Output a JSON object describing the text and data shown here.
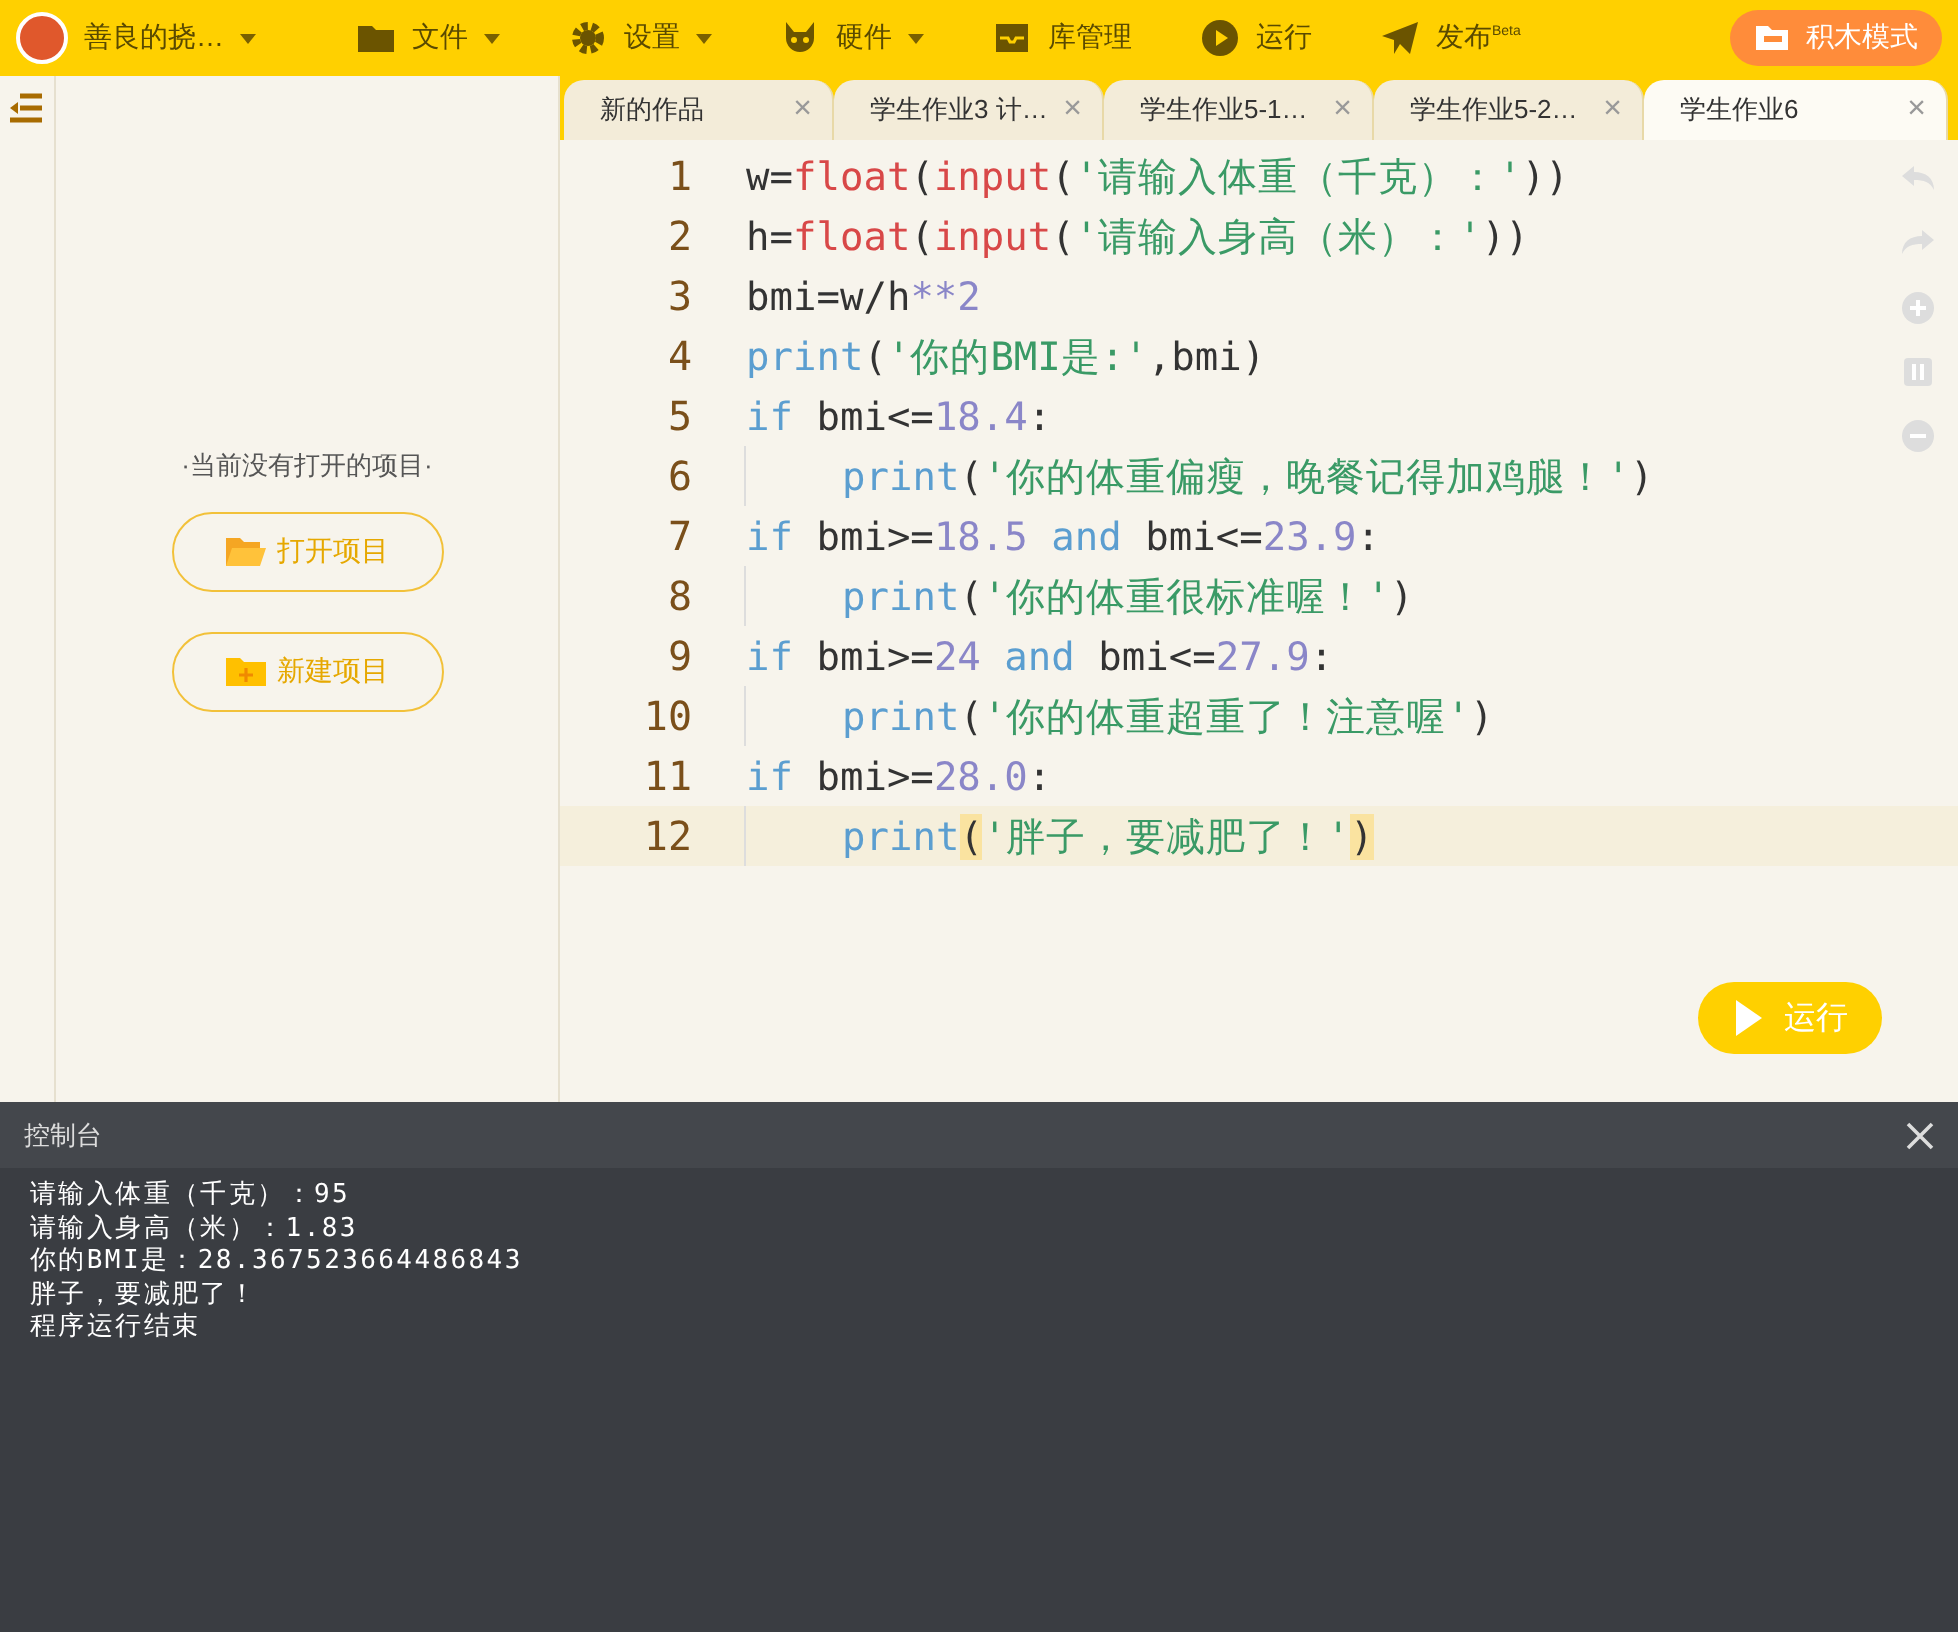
{
  "toolbar": {
    "user": {
      "label": "善良的挠…",
      "dropdown": true
    },
    "menus": [
      {
        "kind": "folder",
        "label": "文件",
        "dropdown": true
      },
      {
        "kind": "gear",
        "label": "设置",
        "dropdown": true
      },
      {
        "kind": "hardware",
        "label": "硬件",
        "dropdown": true
      },
      {
        "kind": "library",
        "label": "库管理",
        "dropdown": false
      },
      {
        "kind": "run",
        "label": "运行",
        "dropdown": false
      },
      {
        "kind": "send",
        "label": "发布$^{Beta}$",
        "dropdown": false
      }
    ],
    "mode_button": "积木模式"
  },
  "sidebar": {
    "message": "·当前没有打开的项目·",
    "buttons": [
      {
        "kind": "open",
        "label": "打开项目"
      },
      {
        "kind": "new",
        "label": "新建项目"
      }
    ]
  },
  "tabs": [
    {
      "label": "新的作品",
      "close": "×",
      "selected": false
    },
    {
      "label": "学生作业3 计…",
      "close": "×",
      "selected": false
    },
    {
      "label": "学生作业5-1…",
      "close": "×",
      "selected": false
    },
    {
      "label": "学生作业5-2…",
      "close": "×",
      "selected": false
    },
    {
      "label": "学生作业6",
      "close": "×",
      "selected": true
    }
  ],
  "editor": {
    "lines": [
      {
        "number": "1",
        "indented": false,
        "current": false,
        "tokens": [
          {
            "kind": "plain",
            "text": "w="
          },
          {
            "kind": "builtin",
            "text": "float"
          },
          {
            "kind": "plain",
            "text": "("
          },
          {
            "kind": "builtin",
            "text": "input"
          },
          {
            "kind": "plain",
            "text": "("
          },
          {
            "kind": "string",
            "text": "'请输入体重（千克）：'"
          },
          {
            "kind": "plain",
            "text": "))"
          }
        ]
      },
      {
        "number": "2",
        "indented": false,
        "current": false,
        "tokens": [
          {
            "kind": "plain",
            "text": "h="
          },
          {
            "kind": "builtin",
            "text": "float"
          },
          {
            "kind": "plain",
            "text": "("
          },
          {
            "kind": "builtin",
            "text": "input"
          },
          {
            "kind": "plain",
            "text": "("
          },
          {
            "kind": "string",
            "text": "'请输入身高（米）：'"
          },
          {
            "kind": "plain",
            "text": "))"
          }
        ]
      },
      {
        "number": "3",
        "indented": false,
        "current": false,
        "tokens": [
          {
            "kind": "plain",
            "text": "bmi=w/h"
          },
          {
            "kind": "operator",
            "text": "**"
          },
          {
            "kind": "number",
            "text": "2"
          }
        ]
      },
      {
        "number": "4",
        "indented": false,
        "current": false,
        "tokens": [
          {
            "kind": "keyword",
            "text": "print"
          },
          {
            "kind": "plain",
            "text": "("
          },
          {
            "kind": "string",
            "text": "'你的BMI是:'"
          },
          {
            "kind": "plain",
            "text": ",bmi)"
          }
        ]
      },
      {
        "number": "5",
        "indented": false,
        "current": false,
        "tokens": [
          {
            "kind": "keyword",
            "text": "if"
          },
          {
            "kind": "plain",
            "text": " bmi<="
          },
          {
            "kind": "number",
            "text": "18.4"
          },
          {
            "kind": "plain",
            "text": ":"
          }
        ]
      },
      {
        "number": "6",
        "indented": true,
        "current": false,
        "tokens": [
          {
            "kind": "keyword",
            "text": "print"
          },
          {
            "kind": "plain",
            "text": "("
          },
          {
            "kind": "string",
            "text": "'你的体重偏瘦，晚餐记得加鸡腿！'"
          },
          {
            "kind": "plain",
            "text": ")"
          }
        ]
      },
      {
        "number": "7",
        "indented": false,
        "current": false,
        "tokens": [
          {
            "kind": "keyword",
            "text": "if"
          },
          {
            "kind": "plain",
            "text": " bmi>="
          },
          {
            "kind": "number",
            "text": "18.5"
          },
          {
            "kind": "keyword",
            "text": " and"
          },
          {
            "kind": "plain",
            "text": " bmi<="
          },
          {
            "kind": "number",
            "text": "23.9"
          },
          {
            "kind": "plain",
            "text": ":"
          }
        ]
      },
      {
        "number": "8",
        "indented": true,
        "current": false,
        "tokens": [
          {
            "kind": "keyword",
            "text": "print"
          },
          {
            "kind": "plain",
            "text": "("
          },
          {
            "kind": "string",
            "text": "'你的体重很标准喔！'"
          },
          {
            "kind": "plain",
            "text": ")"
          }
        ]
      },
      {
        "number": "9",
        "indented": false,
        "current": false,
        "tokens": [
          {
            "kind": "keyword",
            "text": "if"
          },
          {
            "kind": "plain",
            "text": " bmi>="
          },
          {
            "kind": "number",
            "text": "24"
          },
          {
            "kind": "keyword",
            "text": " and"
          },
          {
            "kind": "plain",
            "text": " bmi<="
          },
          {
            "kind": "number",
            "text": "27.9"
          },
          {
            "kind": "plain",
            "text": ":"
          }
        ]
      },
      {
        "number": "10",
        "indented": true,
        "current": false,
        "tokens": [
          {
            "kind": "keyword",
            "text": "print"
          },
          {
            "kind": "plain",
            "text": "("
          },
          {
            "kind": "string",
            "text": "'你的体重超重了！注意喔'"
          },
          {
            "kind": "plain",
            "text": ")"
          }
        ]
      },
      {
        "number": "11",
        "indented": false,
        "current": false,
        "tokens": [
          {
            "kind": "keyword",
            "text": "if"
          },
          {
            "kind": "plain",
            "text": " bmi>="
          },
          {
            "kind": "number",
            "text": "28.0"
          },
          {
            "kind": "plain",
            "text": ":"
          }
        ]
      },
      {
        "number": "12",
        "indented": true,
        "current": true,
        "tokens": [
          {
            "kind": "keyword",
            "text": "print"
          },
          {
            "kind": "bracket-match",
            "text": "("
          },
          {
            "kind": "string",
            "text": "'胖子，要减肥了！'"
          },
          {
            "kind": "bracket-match",
            "text": ")"
          }
        ]
      }
    ],
    "run_button": "运行"
  },
  "console": {
    "title": "控制台",
    "lines": [
      "请输入体重（千克）：95",
      "请输入身高（米）：1.83",
      "你的BMI是：28.367523664486843",
      "胖子，要减肥了！",
      "程序运行结束"
    ]
  }
}
